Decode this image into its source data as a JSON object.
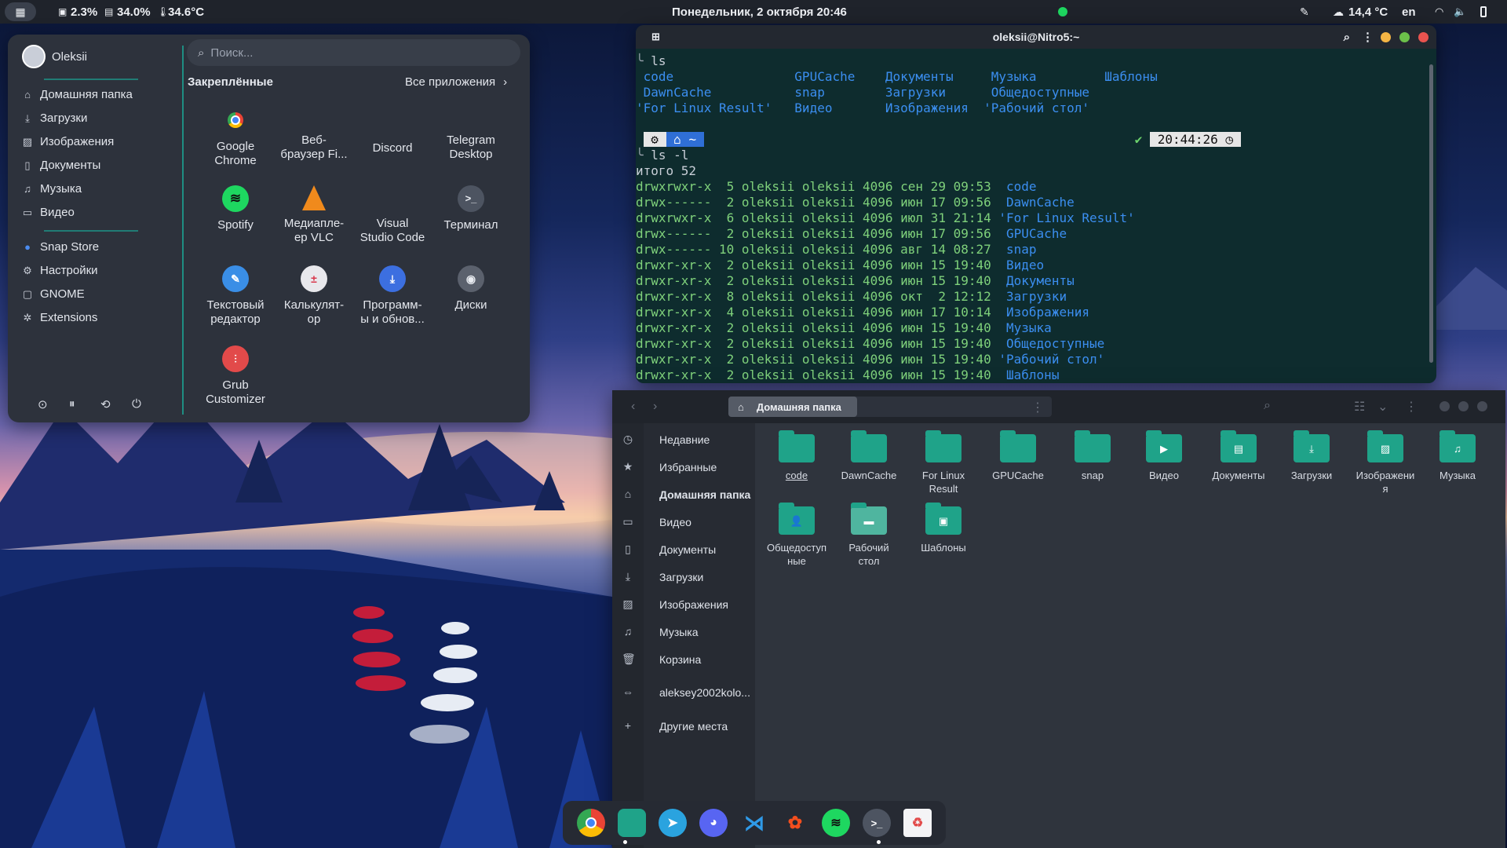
{
  "colors": {
    "accent": "#1fa389",
    "terminal_bg": "#0e2c2e",
    "panel_bg": "#2d323c",
    "green_text": "#7fd17b",
    "blue_text": "#3b8ef0"
  },
  "topbar": {
    "cpu": "2.3%",
    "mem": "34.0%",
    "temp": "34.6°C",
    "datetime": "Понедельник, 2 октября 20:46",
    "weather": "14,4 °C",
    "lang": "en"
  },
  "menu": {
    "user": "Oleksii",
    "places": [
      "Домашняя папка",
      "Загрузки",
      "Изображения",
      "Документы",
      "Музыка",
      "Видео"
    ],
    "extra": [
      "Snap Store",
      "Настройки",
      "GNOME",
      "Extensions"
    ],
    "search_placeholder": "Поиск...",
    "pinned_title": "Закреплённые",
    "all_apps": "Все приложения",
    "apps": [
      {
        "line1": "Google",
        "line2": "Chrome",
        "icon": "chrome-icon"
      },
      {
        "line1": "Веб-",
        "line2": "браузер Fi...",
        "icon": "firefox-icon"
      },
      {
        "line1": "Discord",
        "line2": "",
        "icon": "discord-icon"
      },
      {
        "line1": "Telegram",
        "line2": "Desktop",
        "icon": "telegram-icon"
      },
      {
        "line1": "Spotify",
        "line2": "",
        "icon": "spotify-icon"
      },
      {
        "line1": "Медиапле-",
        "line2": "ер VLC",
        "icon": "vlc-icon"
      },
      {
        "line1": "Visual",
        "line2": "Studio Code",
        "icon": "vscode-icon"
      },
      {
        "line1": "Терминал",
        "line2": "",
        "icon": "terminal-icon"
      },
      {
        "line1": "Текстовый",
        "line2": "редактор",
        "icon": "text-editor-icon"
      },
      {
        "line1": "Калькулят-",
        "line2": "ор",
        "icon": "calculator-icon"
      },
      {
        "line1": "Программ-",
        "line2": "ы и обнов...",
        "icon": "software-icon"
      },
      {
        "line1": "Диски",
        "line2": "",
        "icon": "disks-icon"
      },
      {
        "line1": "Grub",
        "line2": "Customizer",
        "icon": "grub-icon"
      }
    ]
  },
  "terminal": {
    "title": "oleksii@Nitro5:~",
    "cmd1": "ls",
    "ls_row1": [
      "code",
      "GPUCache",
      "Документы",
      "Музыка",
      "Шаблоны"
    ],
    "ls_row2": [
      "DawnCache",
      "snap",
      "Загрузки",
      "Общедоступные"
    ],
    "ls_row3": [
      "'For Linux Result'",
      "Видео",
      "Изображения",
      "'Рабочий стол'"
    ],
    "prompt_time": "20:44:26",
    "cmd2": "ls -l",
    "total": "итого 52",
    "rows": [
      {
        "perm": "drwxrwxr-x  5 oleksii oleksii 4096 сен 29 09:53",
        "name": "code"
      },
      {
        "perm": "drwx------  2 oleksii oleksii 4096 июн 17 09:56",
        "name": "DawnCache"
      },
      {
        "perm": "drwxrwxr-x  6 oleksii oleksii 4096 июл 31 21:14",
        "name": "'For Linux Result'"
      },
      {
        "perm": "drwx------  2 oleksii oleksii 4096 июн 17 09:56",
        "name": "GPUCache"
      },
      {
        "perm": "drwx------ 10 oleksii oleksii 4096 авг 14 08:27",
        "name": "snap"
      },
      {
        "perm": "drwxr-xr-x  2 oleksii oleksii 4096 июн 15 19:40",
        "name": "Видео"
      },
      {
        "perm": "drwxr-xr-x  2 oleksii oleksii 4096 июн 15 19:40",
        "name": "Документы"
      },
      {
        "perm": "drwxr-xr-x  8 oleksii oleksii 4096 окт  2 12:12",
        "name": "Загрузки"
      },
      {
        "perm": "drwxr-xr-x  4 oleksii oleksii 4096 июн 17 10:14",
        "name": "Изображения"
      },
      {
        "perm": "drwxr-xr-x  2 oleksii oleksii 4096 июн 15 19:40",
        "name": "Музыка"
      },
      {
        "perm": "drwxr-xr-x  2 oleksii oleksii 4096 июн 15 19:40",
        "name": "Общедоступные"
      },
      {
        "perm": "drwxr-xr-x  2 oleksii oleksii 4096 июн 15 19:40",
        "name": "'Рабочий стол'"
      },
      {
        "perm": "drwxr-xr-x  2 oleksii oleksii 4096 июн 15 19:40",
        "name": "Шаблоны"
      }
    ]
  },
  "files": {
    "path": "Домашняя папка",
    "sidebar": [
      "Недавние",
      "Избранные",
      "Домашняя папка",
      "Видео",
      "Документы",
      "Загрузки",
      "Изображения",
      "Музыка",
      "Корзина",
      "aleksey2002kolo...",
      "Другие места"
    ],
    "folders": [
      {
        "line1": "code",
        "line2": ""
      },
      {
        "line1": "DawnCache",
        "line2": ""
      },
      {
        "line1": "For Linux",
        "line2": "Result"
      },
      {
        "line1": "GPUCache",
        "line2": ""
      },
      {
        "line1": "snap",
        "line2": ""
      },
      {
        "line1": "Видео",
        "line2": ""
      },
      {
        "line1": "Документы",
        "line2": ""
      },
      {
        "line1": "Загрузки",
        "line2": ""
      },
      {
        "line1": "Изображени",
        "line2": "я"
      },
      {
        "line1": "Музыка",
        "line2": ""
      },
      {
        "line1": "Общедоступ",
        "line2": "ные"
      },
      {
        "line1": "Рабочий",
        "line2": "стол"
      },
      {
        "line1": "Шаблоны",
        "line2": ""
      }
    ]
  },
  "dock": [
    "chrome-icon",
    "files-icon",
    "telegram-icon",
    "discord-icon",
    "vscode-icon",
    "figma-icon",
    "spotify-icon",
    "terminal-icon",
    "trash-icon"
  ]
}
